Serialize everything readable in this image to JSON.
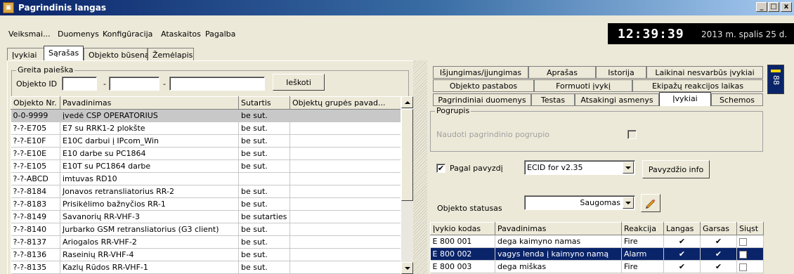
{
  "window": {
    "title": "Pagrindinis langas",
    "minimize": "_",
    "maximize": "□",
    "close": "x"
  },
  "menu": {
    "items": [
      "Veiksmai...",
      "Duomenys",
      "Konfigūracija",
      "Ataskaitos",
      "Pagalba"
    ]
  },
  "clock": {
    "time": "12:39:39",
    "date": "2013 m. spalis 25 d."
  },
  "main_tabs": [
    "Įvykiai",
    "Sąrašas",
    "Objekto būsena",
    "Žemėlapis"
  ],
  "main_tabs_active": "Sąrašas",
  "quick_search": {
    "legend": "Greita paieška",
    "label": "Objekto ID",
    "sep1": "-",
    "sep2": "-",
    "button": "Ieškoti",
    "field1": "",
    "field2": "",
    "field3": ""
  },
  "objects_table": {
    "headers": [
      "Objekto Nr.",
      "Pavadinimas",
      "Sutartis",
      "Objektų grupės pavad..."
    ],
    "rows": [
      [
        "0-0-9999",
        "įvedė CSP OPERATORIUS",
        "be sut.",
        ""
      ],
      [
        "?-?-E705",
        "E7 su RRK1-2 plokšte",
        "be sut.",
        ""
      ],
      [
        "?-?-E10F",
        "E10C darbui į IPcom_Win",
        "be sut.",
        ""
      ],
      [
        "?-?-E10E",
        "E10 darbe su PC1864",
        "be sut.",
        ""
      ],
      [
        "?-?-E105",
        "E10T su PC1864 darbe",
        "be sut.",
        ""
      ],
      [
        "?-?-ABCD",
        "imtuvas RD10",
        "",
        ""
      ],
      [
        "?-?-8184",
        "Jonavos retransliatorius RR-2",
        "be sut.",
        ""
      ],
      [
        "?-?-8183",
        "Prisikėlimo bažnyčios RR-1",
        "be sut.",
        ""
      ],
      [
        "?-?-8149",
        "Savanorių RR-VHF-3",
        "be sutarties",
        ""
      ],
      [
        "?-?-8140",
        "Jurbarko GSM retransliatorius (G3 client)",
        "be sut.",
        ""
      ],
      [
        "?-?-8137",
        "Ariogalos RR-VHF-2",
        "be sut.",
        ""
      ],
      [
        "?-?-8136",
        "Raseinių RR-VHF-4",
        "be sut.",
        ""
      ],
      [
        "?-?-8135",
        "Kazlų Rūdos RR-VHF-1",
        "be sut.",
        ""
      ]
    ]
  },
  "right_tabs": {
    "row1": [
      "Išjungimas/įjungimas",
      "Aprašas",
      "Istorija",
      "Laikinai nesvarbūs įvykiai"
    ],
    "row2": [
      "Objekto pastabos",
      "Formuoti įvykį",
      "Ekipažų reakcijos laikas"
    ],
    "row3": [
      "Pagrindiniai duomenys",
      "Testas",
      "Atsakingi asmenys",
      "Įvykiai",
      "Schemos"
    ],
    "active": "Įvykiai"
  },
  "pogrupis": {
    "legend": "Pogrupis",
    "use_parent_label": "Naudoti pagrindinio pogrupio"
  },
  "template": {
    "checkbox_label": "Pagal pavyzdį",
    "checkbox_mark": "✔",
    "selected": "ECID for v2.35",
    "info_button": "Pavyzdžio info"
  },
  "status": {
    "label": "Objekto statusas",
    "value": "Saugomas"
  },
  "events_table": {
    "headers": [
      "Įvykio kodas",
      "Pavadinimas",
      "Reakcija",
      "Langas",
      "Garsas",
      "Siųst"
    ],
    "rows": [
      [
        "E  800 001",
        "dega kaimyno namas",
        "Fire"
      ],
      [
        "E  800 002",
        "vagys lenda į kaimyno namą",
        "Alarm"
      ],
      [
        "E  800 003",
        "dega miškas",
        "Fire"
      ]
    ],
    "check_mark": "✔"
  },
  "side_strip": {
    "label": "88"
  }
}
